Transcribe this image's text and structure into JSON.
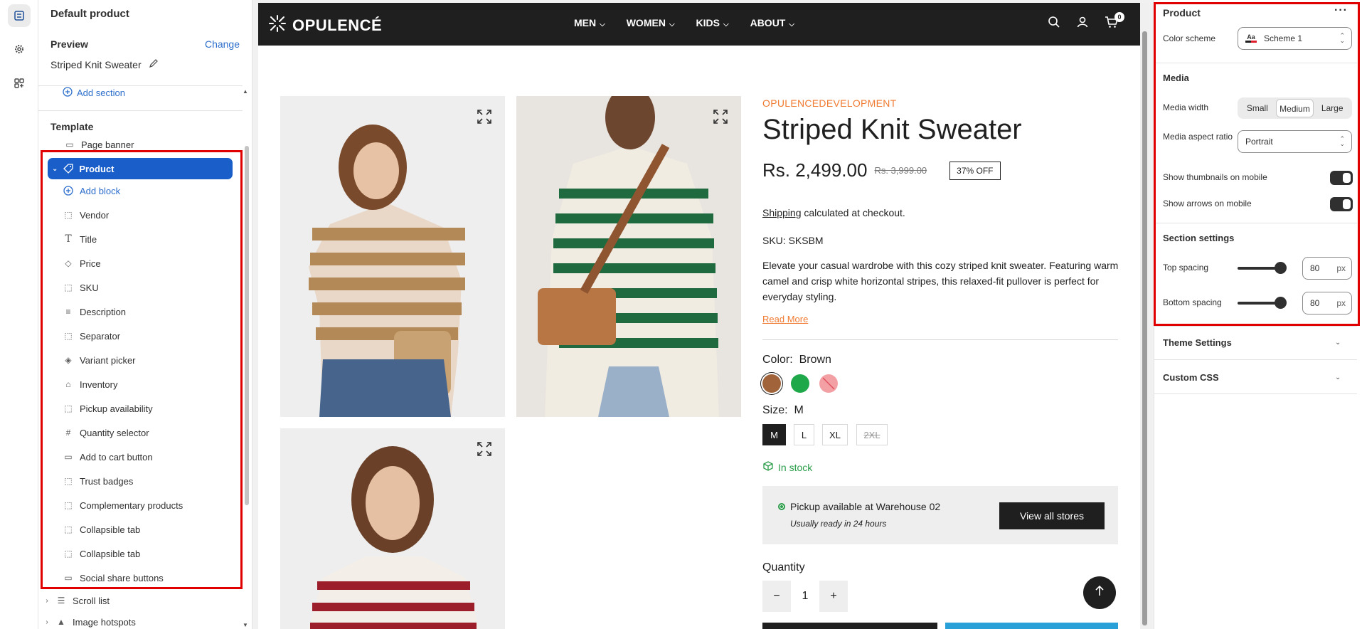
{
  "left_panel": {
    "title": "Default product",
    "preview_label": "Preview",
    "change_label": "Change",
    "preview_value": "Striped Knit Sweater",
    "add_section": "Add section",
    "template_label": "Template",
    "page_banner": "Page banner",
    "product": "Product",
    "add_block": "Add block",
    "blocks": [
      "Vendor",
      "Title",
      "Price",
      "SKU",
      "Description",
      "Separator",
      "Variant picker",
      "Inventory",
      "Pickup availability",
      "Quantity selector",
      "Add to cart button",
      "Trust badges",
      "Complementary products",
      "Collapsible tab",
      "Collapsible tab",
      "Social share buttons"
    ],
    "after_sections": [
      "Scroll list",
      "Image hotspots"
    ]
  },
  "store": {
    "logo": "OPULENCÉ",
    "menu": [
      "MEN",
      "WOMEN",
      "KIDS",
      "ABOUT"
    ],
    "cart_count": "0",
    "vendor": "OPULENCEDEVELOPMENT",
    "title": "Striped Knit Sweater",
    "price": "Rs. 2,499.00",
    "compare_price": "Rs. 3,999.00",
    "discount": "37% OFF",
    "shipping_link": "Shipping",
    "shipping_rest": " calculated at checkout.",
    "sku": "SKU: SKSBM",
    "description": "Elevate your casual wardrobe with this cozy striped knit sweater. Featuring warm camel and crisp white horizontal stripes, this relaxed-fit pullover is perfect for everyday styling.",
    "read_more": "Read More",
    "color_label": "Color:",
    "color_value": "Brown",
    "colors": [
      "#a0633a",
      "#1ea84a",
      "#f3a0a5"
    ],
    "size_label": "Size:",
    "size_value": "M",
    "sizes": [
      "M",
      "L",
      "XL",
      "2XL"
    ],
    "in_stock": "In stock",
    "pickup_title": "Pickup available at Warehouse 02",
    "pickup_sub": "Usually ready in 24 hours",
    "view_stores": "View all stores",
    "quantity_label": "Quantity",
    "quantity_value": "1",
    "minus": "−",
    "plus": "+"
  },
  "right_panel": {
    "title": "Product",
    "color_scheme_label": "Color scheme",
    "color_scheme_value": "Scheme 1",
    "media_heading": "Media",
    "media_width_label": "Media width",
    "media_width_options": [
      "Small",
      "Medium",
      "Large"
    ],
    "media_width_selected": "Medium",
    "aspect_label": "Media aspect ratio",
    "aspect_value": "Portrait",
    "thumbs_label": "Show thumbnails on mobile",
    "thumbs_on": true,
    "arrows_label": "Show arrows on mobile",
    "arrows_on": true,
    "section_settings": "Section settings",
    "top_spacing_label": "Top spacing",
    "top_spacing_value": "80",
    "bottom_spacing_label": "Bottom spacing",
    "bottom_spacing_value": "80",
    "unit": "px",
    "theme_settings": "Theme Settings",
    "custom_css": "Custom CSS"
  }
}
